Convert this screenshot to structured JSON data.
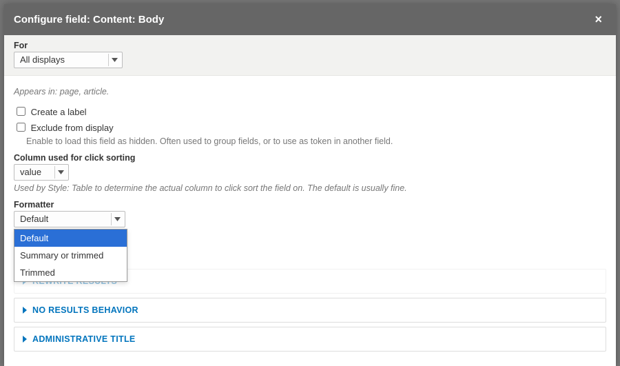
{
  "header": {
    "title": "Configure field: Content: Body"
  },
  "for": {
    "label": "For",
    "selected": "All displays"
  },
  "appears_in": "Appears in: page, article.",
  "create_label": {
    "label": "Create a label"
  },
  "exclude": {
    "label": "Exclude from display",
    "desc": "Enable to load this field as hidden. Often used to group fields, or to use as token in another field."
  },
  "click_sort": {
    "label": "Column used for click sorting",
    "selected": "value",
    "hint": "Used by Style: Table to determine the actual column to click sort the field on. The default is usually fine."
  },
  "formatter": {
    "label": "Formatter",
    "selected": "Default",
    "options": [
      "Default",
      "Summary or trimmed",
      "Trimmed"
    ]
  },
  "accordions": {
    "rewrite": "REWRITE RESULTS",
    "no_results": "NO RESULTS BEHAVIOR",
    "admin_title": "ADMINISTRATIVE TITLE"
  }
}
